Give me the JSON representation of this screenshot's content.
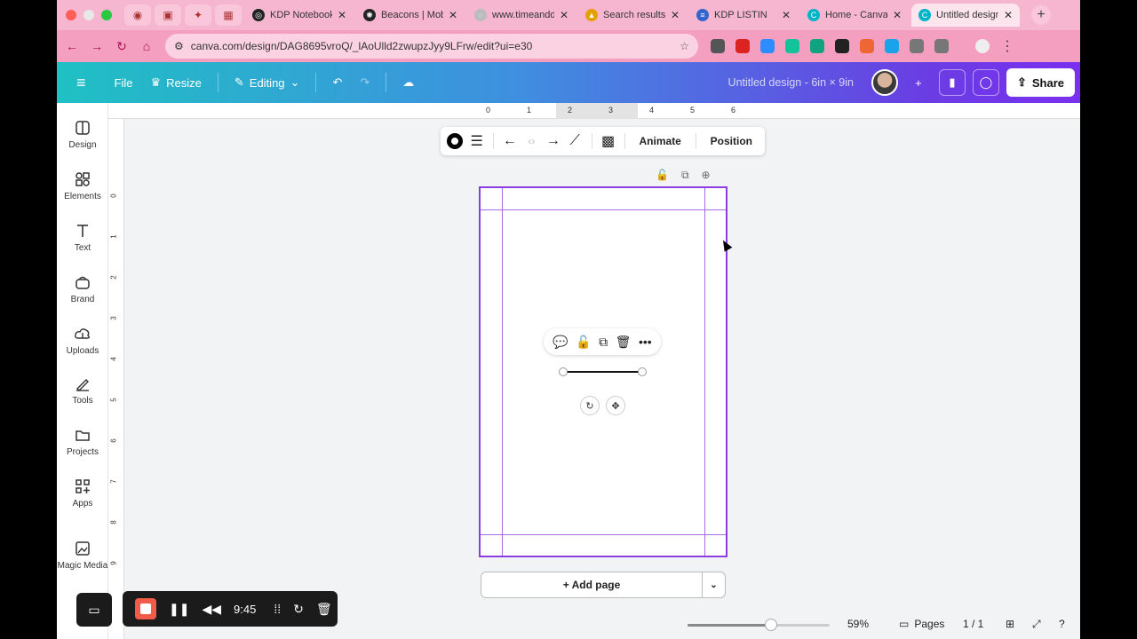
{
  "browser": {
    "tabs": [
      {
        "label": "KDP Notebook",
        "color": "#222"
      },
      {
        "label": "Beacons | Mob",
        "color": "#222"
      },
      {
        "label": "www.timeandd",
        "color": "#aaa"
      },
      {
        "label": "Search results",
        "color": "#e5a000"
      },
      {
        "label": "KDP LISTIN",
        "color": "#3366cc"
      },
      {
        "label": "Home - Canva",
        "color": "#00b4c8"
      },
      {
        "label": "Untitled design",
        "color": "#00b4c8"
      }
    ],
    "url": "canva.com/design/DAG8695vroQ/_lAoUlld2zwupzJyy9LFrw/edit?ui=e30"
  },
  "header": {
    "menu_label": "File",
    "resize_label": "Resize",
    "editing_label": "Editing",
    "doc_title": "Untitled design - 6in × 9in",
    "share_label": "Share"
  },
  "sidebar": {
    "items": [
      {
        "label": "Design",
        "icon": "design-icon"
      },
      {
        "label": "Elements",
        "icon": "elements-icon"
      },
      {
        "label": "Text",
        "icon": "text-icon"
      },
      {
        "label": "Brand",
        "icon": "brand-icon"
      },
      {
        "label": "Uploads",
        "icon": "uploads-icon"
      },
      {
        "label": "Tools",
        "icon": "tools-icon"
      },
      {
        "label": "Projects",
        "icon": "projects-icon"
      },
      {
        "label": "Apps",
        "icon": "apps-icon"
      },
      {
        "label": "Magic Media",
        "icon": "magic-media-icon"
      }
    ]
  },
  "ruler": {
    "top": [
      "0",
      "1",
      "2",
      "3",
      "4",
      "5",
      "6"
    ],
    "left": [
      "0",
      "1",
      "2",
      "3",
      "4",
      "5",
      "6",
      "7",
      "8",
      "9"
    ]
  },
  "toolbar": {
    "animate_label": "Animate",
    "position_label": "Position"
  },
  "canvas": {
    "add_page_label": "+ Add page"
  },
  "bottom": {
    "zoom_value": "59%",
    "zoom_fraction": 0.59,
    "pages_label": "Pages",
    "page_count": "1 / 1"
  },
  "recorder": {
    "time": "9:45"
  },
  "colors": {
    "accent": "#8b3dde",
    "header_start": "#1fc0c4",
    "header_end": "#7a2ff0"
  }
}
